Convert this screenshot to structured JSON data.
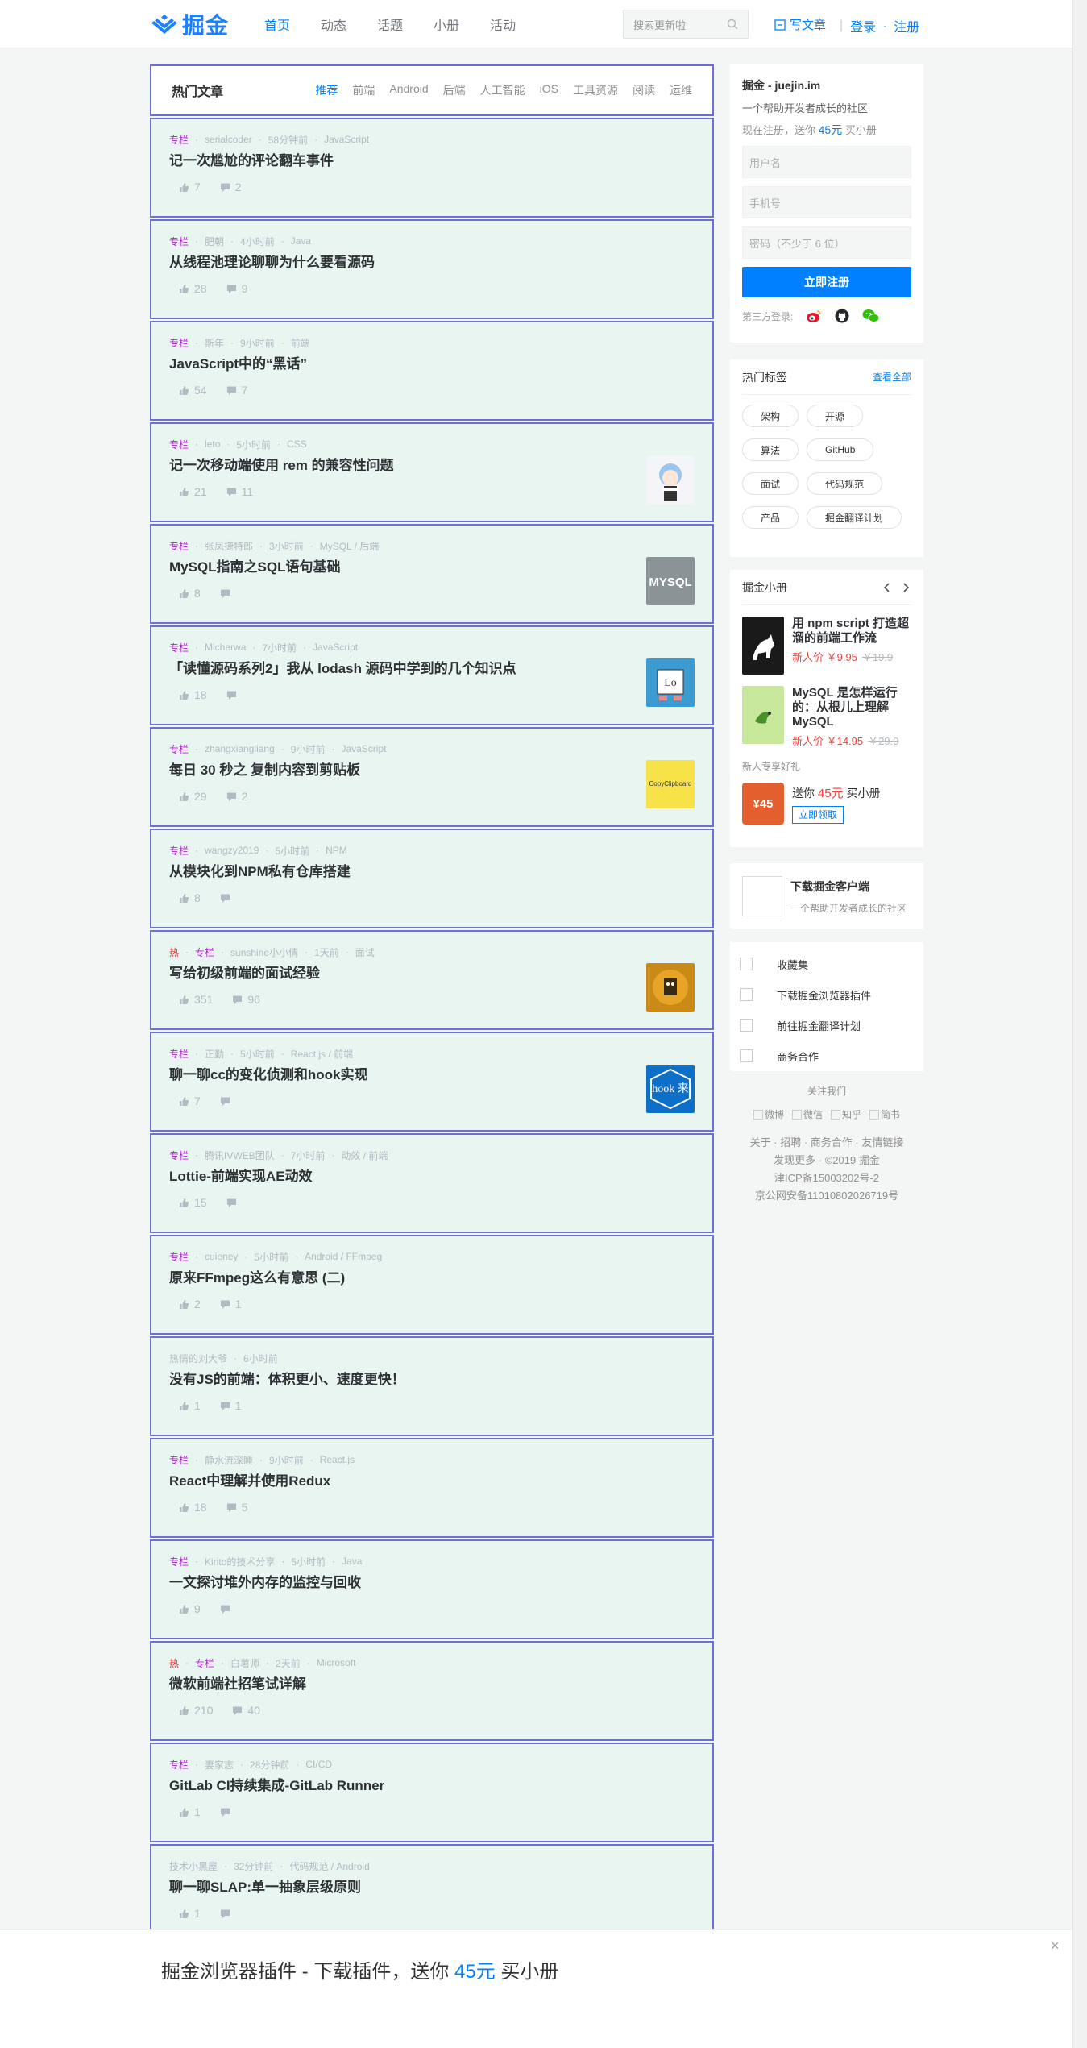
{
  "header": {
    "logo": "掘金",
    "nav": [
      "首页",
      "动态",
      "话题",
      "小册",
      "活动"
    ],
    "search_placeholder": "搜索更新啦",
    "write": "写文章",
    "login": "登录",
    "register": "注册",
    "accent": "#007fff"
  },
  "feed": {
    "title": "热门文章",
    "tabs": [
      "推荐",
      "前端",
      "Android",
      "后端",
      "人工智能",
      "iOS",
      "工具资源",
      "阅读",
      "运维"
    ],
    "items": [
      {
        "tags": [
          "专栏"
        ],
        "author": "serialcoder",
        "time": "58分钟前",
        "category": "JavaScript",
        "title": "记一次尴尬的评论翻车事件",
        "likes": "7",
        "comments": "2",
        "thumb": ""
      },
      {
        "tags": [
          "专栏"
        ],
        "author": "肥朝",
        "time": "4小时前",
        "category": "Java",
        "title": "从线程池理论聊聊为什么要看源码",
        "likes": "28",
        "comments": "9",
        "thumb": ""
      },
      {
        "tags": [
          "专栏"
        ],
        "author": "斯年",
        "time": "9小时前",
        "category": "前端",
        "title": "JavaScript中的“黑话”",
        "likes": "54",
        "comments": "7",
        "thumb": ""
      },
      {
        "tags": [
          "专栏"
        ],
        "author": "leto",
        "time": "5小时前",
        "category": "CSS",
        "title": "记一次移动端使用 rem 的兼容性问题",
        "likes": "21",
        "comments": "11",
        "thumb": "anime"
      },
      {
        "tags": [
          "专栏"
        ],
        "author": "张凤捷特郎",
        "time": "3小时前",
        "category": "MySQL / 后端",
        "title": "MySQL指南之SQL语句基础",
        "likes": "8",
        "comments": "",
        "thumb": "mysql"
      },
      {
        "tags": [
          "专栏"
        ],
        "author": "Micherwa",
        "time": "7小时前",
        "category": "JavaScript",
        "title": "「读懂源码系列2」我从 lodash 源码中学到的几个知识点",
        "likes": "18",
        "comments": "",
        "thumb": "lodash"
      },
      {
        "tags": [
          "专栏"
        ],
        "author": "zhangxiangliang",
        "time": "9小时前",
        "category": "JavaScript",
        "title": "每日 30 秒之 复制内容到剪贴板",
        "likes": "29",
        "comments": "2",
        "thumb": "clipboard"
      },
      {
        "tags": [
          "专栏"
        ],
        "author": "wangzy2019",
        "time": "5小时前",
        "category": "NPM",
        "title": "从模块化到NPM私有仓库搭建",
        "likes": "8",
        "comments": "",
        "thumb": ""
      },
      {
        "tags": [
          "热",
          "专栏"
        ],
        "author": "sunshine小小倩",
        "time": "1天前",
        "category": "面试",
        "title": "写给初级前端的面试经验",
        "likes": "351",
        "comments": "96",
        "thumb": "cat"
      },
      {
        "tags": [
          "专栏"
        ],
        "author": "正勤",
        "time": "5小时前",
        "category": "React.js / 前端",
        "title": "聊一聊cc的变化侦测和hook实现",
        "likes": "7",
        "comments": "",
        "thumb": "hook"
      },
      {
        "tags": [
          "专栏"
        ],
        "author": "腾讯IVWEB团队",
        "time": "7小时前",
        "category": "动效 / 前端",
        "title": "Lottie-前端实现AE动效",
        "likes": "15",
        "comments": "",
        "thumb": ""
      },
      {
        "tags": [
          "专栏"
        ],
        "author": "cuieney",
        "time": "5小时前",
        "category": "Android / FFmpeg",
        "title": "原来FFmpeg这么有意思 (二)",
        "likes": "2",
        "comments": "1",
        "thumb": ""
      },
      {
        "tags": [],
        "author": "热情的刘大爷",
        "time": "6小时前",
        "category": "",
        "title": "没有JS的前端：体积更小、速度更快！",
        "likes": "1",
        "comments": "1",
        "thumb": ""
      },
      {
        "tags": [
          "专栏"
        ],
        "author": "静水流深睡",
        "time": "9小时前",
        "category": "React.js",
        "title": "React中理解并使用Redux",
        "likes": "18",
        "comments": "5",
        "thumb": ""
      },
      {
        "tags": [
          "专栏"
        ],
        "author": "Kirito的技术分享",
        "time": "5小时前",
        "category": "Java",
        "title": "一文探讨堆外内存的监控与回收",
        "likes": "9",
        "comments": "",
        "thumb": ""
      },
      {
        "tags": [
          "热",
          "专栏"
        ],
        "author": "白薯师",
        "time": "2天前",
        "category": "Microsoft",
        "title": "微软前端社招笔试详解",
        "likes": "210",
        "comments": "40",
        "thumb": ""
      },
      {
        "tags": [
          "专栏"
        ],
        "author": "妻家志",
        "time": "28分钟前",
        "category": "CI/CD",
        "title": "GitLab CI持续集成-GitLab Runner",
        "likes": "1",
        "comments": "",
        "thumb": ""
      },
      {
        "tags": [],
        "author": "技术小黑屋",
        "time": "32分钟前",
        "category": "代码规范 / Android",
        "title": "聊一聊SLAP:单一抽象层级原则",
        "likes": "1",
        "comments": "",
        "thumb": ""
      }
    ]
  },
  "register": {
    "title": "掘金 - juejin.im",
    "subtitle": "一个帮助开发者成长的社区",
    "promo_prefix": "现在注册，送你",
    "promo_amount": "45元",
    "promo_suffix": "买小册",
    "username": "用户名",
    "phone": "手机号",
    "password": "密码（不少于 6 位）",
    "button": "立即注册",
    "third": "第三方登录:"
  },
  "hot_tags": {
    "title": "热门标签",
    "more": "查看全部",
    "tags": [
      "架构",
      "开源",
      "算法",
      "GitHub",
      "面试",
      "代码规范",
      "产品",
      "掘金翻译计划"
    ]
  },
  "books": {
    "title": "掘金小册",
    "items": [
      {
        "title": "用 npm script 打造超溜的前端工作流",
        "price": "新人价 ￥9.95",
        "orig": "￥19.9",
        "color": "#1a1a1a"
      },
      {
        "title": "MySQL 是怎样运行的：从根儿上理解 MySQL",
        "price": "新人价 ￥14.95",
        "orig": "￥29.9",
        "color": "#8fd14f"
      }
    ],
    "newbie": "新人专享好礼",
    "gift_box": "¥45",
    "gift_prefix": "送你",
    "gift_amount": "45元",
    "gift_suffix": "买小册",
    "gift_btn": "立即领取"
  },
  "app": {
    "title": "下载掘金客户端",
    "subtitle": "一个帮助开发者成长的社区"
  },
  "links": [
    "收藏集",
    "下载掘金浏览器插件",
    "前往掘金翻译计划",
    "商务合作"
  ],
  "follow": {
    "title": "关注我们",
    "icons": [
      "微博",
      "微信",
      "知乎",
      "简书"
    ]
  },
  "footer": {
    "line1": [
      "关于",
      "招聘",
      "商务合作",
      "友情链接"
    ],
    "line2": [
      "发现更多",
      "©2019 掘金"
    ],
    "line3": "津ICP备15003202号-2",
    "line4": "京公网安备11010802026719号"
  },
  "banner": {
    "prefix": "掘金浏览器插件 - 下载插件，送你 ",
    "amount": "45元",
    "suffix": " 买小册",
    "close": "×"
  }
}
